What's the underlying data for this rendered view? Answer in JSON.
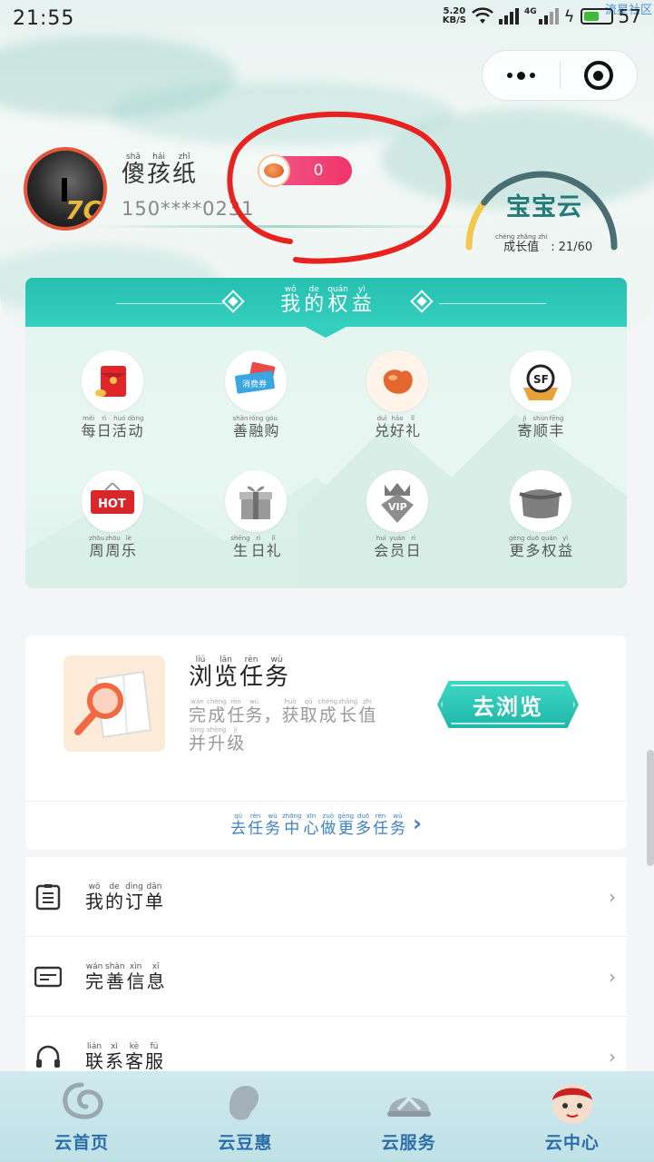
{
  "status_bar": {
    "time": "21:55",
    "speed_top": "5.20",
    "speed_unit": "KB/S",
    "network": "4G",
    "battery": "57",
    "watermark": "流星社区"
  },
  "profile": {
    "nickname": [
      {
        "py": "shǎ",
        "hz": "傻"
      },
      {
        "py": "hái",
        "hz": "孩"
      },
      {
        "py": "zhǐ",
        "hz": "纸"
      }
    ],
    "phone": "150****0231",
    "avatar_badge": "7C",
    "beans": "0"
  },
  "level": {
    "name": "宝宝云",
    "growth_label": "成长值",
    "growth_py": "chéng zhǎng zhí",
    "growth_value": "21/60",
    "progress": 0.35
  },
  "benefits": {
    "title": [
      {
        "py": "wǒ",
        "hz": "我"
      },
      {
        "py": "de",
        "hz": "的"
      },
      {
        "py": "quán",
        "hz": "权"
      },
      {
        "py": "yì",
        "hz": "益"
      }
    ],
    "items": [
      {
        "icon": "red-envelope-icon",
        "chars": [
          {
            "py": "měi",
            "hz": "每"
          },
          {
            "py": "rì",
            "hz": "日"
          },
          {
            "py": "huó",
            "hz": "活"
          },
          {
            "py": "dòng",
            "hz": "动"
          }
        ]
      },
      {
        "icon": "coupon-icon",
        "chars": [
          {
            "py": "shàn",
            "hz": "善"
          },
          {
            "py": "róng",
            "hz": "融"
          },
          {
            "py": "gòu",
            "hz": "购"
          }
        ]
      },
      {
        "icon": "bean-icon",
        "chars": [
          {
            "py": "duì",
            "hz": "兑"
          },
          {
            "py": "hǎo",
            "hz": "好"
          },
          {
            "py": "lǐ",
            "hz": "礼"
          }
        ]
      },
      {
        "icon": "sf-express-icon",
        "chars": [
          {
            "py": "jì",
            "hz": "寄"
          },
          {
            "py": "shùn",
            "hz": "顺"
          },
          {
            "py": "fēng",
            "hz": "丰"
          }
        ]
      },
      {
        "icon": "hot-sign-icon",
        "chars": [
          {
            "py": "zhōu",
            "hz": "周"
          },
          {
            "py": "zhōu",
            "hz": "周"
          },
          {
            "py": "lè",
            "hz": "乐"
          }
        ]
      },
      {
        "icon": "gift-box-icon",
        "chars": [
          {
            "py": "shēng",
            "hz": "生"
          },
          {
            "py": "rì",
            "hz": "日"
          },
          {
            "py": "lǐ",
            "hz": "礼"
          }
        ]
      },
      {
        "icon": "vip-crown-icon",
        "chars": [
          {
            "py": "huì",
            "hz": "会"
          },
          {
            "py": "yuán",
            "hz": "员"
          },
          {
            "py": "rì",
            "hz": "日"
          }
        ]
      },
      {
        "icon": "bag-icon",
        "chars": [
          {
            "py": "gèng",
            "hz": "更"
          },
          {
            "py": "duō",
            "hz": "多"
          },
          {
            "py": "quán",
            "hz": "权"
          },
          {
            "py": "yì",
            "hz": "益"
          }
        ]
      }
    ],
    "hot_text": "HOT",
    "vip_text": "VIP",
    "coupon_text": "消费券",
    "sf_text": "SF"
  },
  "task": {
    "title": [
      {
        "py": "liú",
        "hz": "浏"
      },
      {
        "py": "lǎn",
        "hz": "览"
      },
      {
        "py": "rèn",
        "hz": "任"
      },
      {
        "py": "wù",
        "hz": "务"
      }
    ],
    "desc_line1": [
      {
        "py": "wán",
        "hz": "完"
      },
      {
        "py": "chéng",
        "hz": "成"
      },
      {
        "py": "rèn",
        "hz": "任"
      },
      {
        "py": "wù",
        "hz": "务"
      },
      {
        "py": "",
        "hz": "，"
      },
      {
        "py": "huò",
        "hz": "获"
      },
      {
        "py": "qǔ",
        "hz": "取"
      },
      {
        "py": "chéng",
        "hz": "成"
      },
      {
        "py": "zhǎng",
        "hz": "长"
      },
      {
        "py": "zhí",
        "hz": "值"
      }
    ],
    "desc_line2": [
      {
        "py": "bìng",
        "hz": "并"
      },
      {
        "py": "shēng",
        "hz": "升"
      },
      {
        "py": "jí",
        "hz": "级"
      }
    ],
    "button": "去浏览",
    "more": [
      {
        "py": "qù",
        "hz": "去"
      },
      {
        "py": "rèn",
        "hz": "任"
      },
      {
        "py": "wù",
        "hz": "务"
      },
      {
        "py": "zhōng",
        "hz": "中"
      },
      {
        "py": "xīn",
        "hz": "心"
      },
      {
        "py": "zuò",
        "hz": "做"
      },
      {
        "py": "gèng",
        "hz": "更"
      },
      {
        "py": "duō",
        "hz": "多"
      },
      {
        "py": "rèn",
        "hz": "任"
      },
      {
        "py": "wù",
        "hz": "务"
      }
    ],
    "more_arrow": "›"
  },
  "menu": [
    {
      "icon": "order-list-icon",
      "chars": [
        {
          "py": "wǒ",
          "hz": "我"
        },
        {
          "py": "de",
          "hz": "的"
        },
        {
          "py": "dìng",
          "hz": "订"
        },
        {
          "py": "dān",
          "hz": "单"
        }
      ]
    },
    {
      "icon": "id-card-icon",
      "chars": [
        {
          "py": "wán",
          "hz": "完"
        },
        {
          "py": "shàn",
          "hz": "善"
        },
        {
          "py": "xìn",
          "hz": "信"
        },
        {
          "py": "xī",
          "hz": "息"
        }
      ]
    },
    {
      "icon": "headset-icon",
      "chars": [
        {
          "py": "lián",
          "hz": "联"
        },
        {
          "py": "xì",
          "hz": "系"
        },
        {
          "py": "kè",
          "hz": "客"
        },
        {
          "py": "fú",
          "hz": "服"
        }
      ]
    }
  ],
  "menu_chevron": "›",
  "tabbar": [
    {
      "icon": "cloud-swirl-icon",
      "label": "云首页"
    },
    {
      "icon": "bean-icon",
      "label": "云豆惠"
    },
    {
      "icon": "service-hat-icon",
      "label": "云服务"
    },
    {
      "icon": "mascot-avatar-icon",
      "label": "云中心"
    }
  ]
}
